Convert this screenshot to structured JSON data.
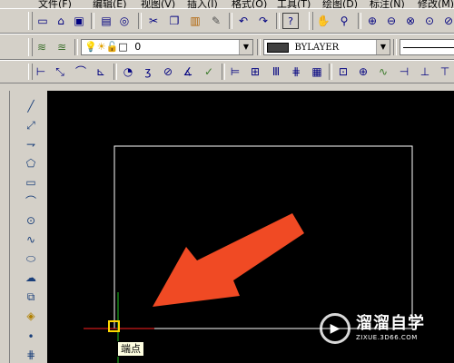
{
  "menu": {
    "items": [
      "文件(F)",
      "编辑(E)",
      "视图(V)",
      "插入(I)",
      "格式(O)",
      "工具(T)",
      "绘图(D)",
      "标注(N)",
      "修改(M)"
    ]
  },
  "standard_toolbar": {
    "icons": [
      "new-icon",
      "open-icon",
      "save-icon",
      "print-icon",
      "preview-icon",
      "cut-icon",
      "copy-icon",
      "paste-icon",
      "match-properties-icon",
      "undo-icon",
      "redo-icon",
      "help-icon",
      "pan-icon",
      "zoom-realtime-icon",
      "zoom-in-icon",
      "zoom-out-icon",
      "zoom-window-icon",
      "zoom-extents-icon",
      "zoom-previous-icon"
    ]
  },
  "layer_toolbar": {
    "layer_value": "0",
    "color_value": "BYLAYER"
  },
  "dimension_toolbar": {
    "icons": [
      "linear-dim-icon",
      "aligned-dim-icon",
      "arc-length-icon",
      "ordinate-icon",
      "radius-icon",
      "jogged-icon",
      "diameter-icon",
      "angular-icon",
      "quick-dim-icon",
      "baseline-icon",
      "continue-icon",
      "dim-space-icon",
      "dim-break-icon",
      "tolerance-icon",
      "center-mark-icon",
      "inspect-icon",
      "jogged-linear-icon",
      "dim-edit-icon",
      "dim-text-edit-icon"
    ]
  },
  "draw_toolbar": {
    "icons": [
      "line-icon",
      "construction-line-icon",
      "polyline-icon",
      "polygon-icon",
      "rectangle-icon",
      "arc-icon",
      "circle-icon",
      "spline-icon",
      "ellipse-icon",
      "revision-cloud-icon",
      "insert-block-icon",
      "make-block-icon",
      "point-icon",
      "hatch-icon"
    ]
  },
  "tooltip": {
    "text": "端点"
  },
  "watermark": {
    "title": "溜溜自学",
    "url": "ZIXUE.3D66.COM"
  },
  "colors": {
    "canvas": "#000000",
    "arrow": "#f04a24",
    "ucs_x": "#ff2020",
    "ucs_y": "#22c322",
    "snap_marker": "#ffd700"
  }
}
